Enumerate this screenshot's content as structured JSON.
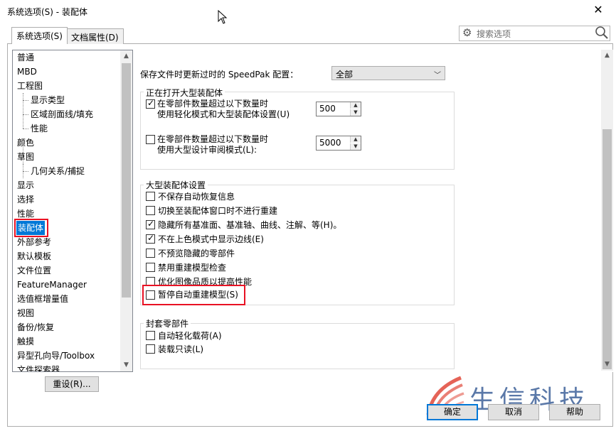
{
  "window": {
    "title": "系统选项(S) - 装配体",
    "close_glyph": "✕"
  },
  "tabs": [
    {
      "label": "系统选项(S)",
      "active": true
    },
    {
      "label": "文档属性(D)",
      "active": false
    }
  ],
  "search": {
    "placeholder": "搜索选项",
    "icon": "gear-icon",
    "search_icon": "magnifier-icon"
  },
  "tree": {
    "items": [
      {
        "label": "普通",
        "level": 0
      },
      {
        "label": "MBD",
        "level": 0
      },
      {
        "label": "工程图",
        "level": 0
      },
      {
        "label": "显示类型",
        "level": 1
      },
      {
        "label": "区域剖面线/填充",
        "level": 1
      },
      {
        "label": "性能",
        "level": 1
      },
      {
        "label": "颜色",
        "level": 0
      },
      {
        "label": "草图",
        "level": 0
      },
      {
        "label": "几何关系/捕捉",
        "level": 1
      },
      {
        "label": "显示",
        "level": 0
      },
      {
        "label": "选择",
        "level": 0
      },
      {
        "label": "性能",
        "level": 0
      },
      {
        "label": "装配体",
        "level": 0,
        "selected": true
      },
      {
        "label": "外部参考",
        "level": 0
      },
      {
        "label": "默认模板",
        "level": 0
      },
      {
        "label": "文件位置",
        "level": 0
      },
      {
        "label": "FeatureManager",
        "level": 0
      },
      {
        "label": "选值框增量值",
        "level": 0
      },
      {
        "label": "视图",
        "level": 0
      },
      {
        "label": "备份/恢复",
        "level": 0
      },
      {
        "label": "触摸",
        "level": 0
      },
      {
        "label": "异型孔向导/Toolbox",
        "level": 0
      },
      {
        "label": "文件探索器",
        "level": 0
      }
    ]
  },
  "reset_button": "重设(R)...",
  "speedpak": {
    "label": "保存文件时更新过时的 SpeedPak 配置：",
    "value": "全部"
  },
  "large_open": {
    "title": "正在打开大型装配体",
    "option1": {
      "line1": "在零部件数量超过以下数量时",
      "line2": "使用轻化模式和大型装配体设置(U)",
      "checked": true,
      "value": "500"
    },
    "option2": {
      "line1": "在零部件数量超过以下数量时",
      "line2": "使用大型设计审阅模式(L):",
      "checked": false,
      "value": "5000"
    }
  },
  "large_settings": {
    "title": "大型装配体设置",
    "items": [
      {
        "label": "不保存自动恢复信息",
        "checked": false
      },
      {
        "label": "切换至装配体窗口时不进行重建",
        "checked": false
      },
      {
        "label": "隐藏所有基准面、基准轴、曲线、注解、等(H)。",
        "checked": true
      },
      {
        "label": "不在上色模式中显示边线(E)",
        "checked": true
      },
      {
        "label": "不预览隐藏的零部件",
        "checked": false
      },
      {
        "label": "禁用重建模型检查",
        "checked": false
      },
      {
        "label": "优化图像品质以提高性能",
        "checked": false
      },
      {
        "label": "暂停自动重建模型(S)",
        "checked": false,
        "highlighted": true
      }
    ]
  },
  "envelope": {
    "title": "封套零部件",
    "items": [
      {
        "label": "自动轻化载荷(A)",
        "checked": false
      },
      {
        "label": "装载只读(L)",
        "checked": false
      }
    ]
  },
  "buttons": {
    "ok": "确定",
    "cancel": "取消",
    "help": "帮助"
  },
  "watermark": {
    "text": "生信科技"
  },
  "colors": {
    "selection": "#0078d7",
    "highlight": "#e81123",
    "watermark": "#5a78a8",
    "watermark_logo": "#e0483a"
  }
}
